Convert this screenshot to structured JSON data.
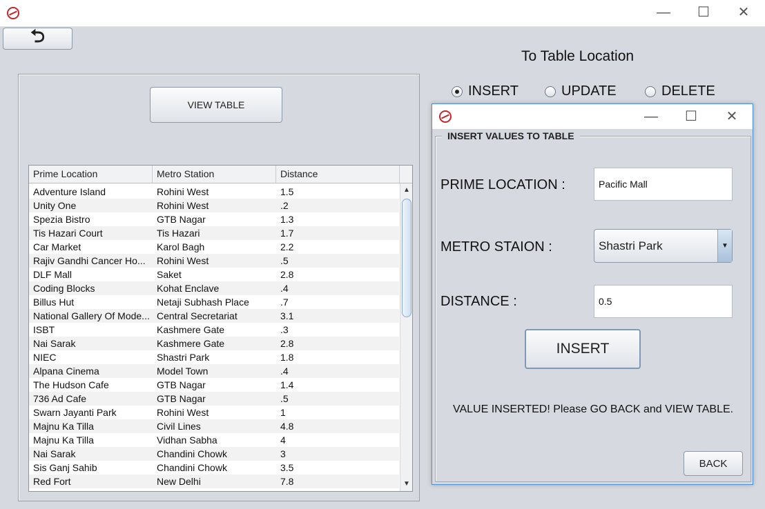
{
  "window": {
    "minimize": "—",
    "maximize": "☐",
    "close": "✕"
  },
  "toolbar": {
    "back_symbol": "⮌"
  },
  "header": {
    "title": "To Table Location"
  },
  "left": {
    "view_button": "VIEW TABLE",
    "table": {
      "columns": [
        "Prime Location",
        "Metro Station",
        "Distance"
      ],
      "rows": [
        [
          "Adventure Island",
          "Rohini West",
          "1.5"
        ],
        [
          "Unity One",
          "Rohini West",
          ".2"
        ],
        [
          "Spezia Bistro",
          "GTB Nagar",
          "1.3"
        ],
        [
          "Tis Hazari Court",
          "Tis Hazari",
          "1.7"
        ],
        [
          "Car Market",
          "Karol Bagh",
          "2.2"
        ],
        [
          "Rajiv Gandhi Cancer Ho...",
          "Rohini West",
          ".5"
        ],
        [
          "DLF Mall",
          "Saket",
          "2.8"
        ],
        [
          "Coding Blocks",
          "Kohat Enclave",
          ".4"
        ],
        [
          "Billus Hut",
          "Netaji Subhash Place",
          ".7"
        ],
        [
          "National Gallery Of Mode...",
          "Central Secretariat",
          "3.1"
        ],
        [
          "ISBT",
          "Kashmere Gate",
          ".3"
        ],
        [
          "Nai Sarak",
          "Kashmere Gate",
          "2.8"
        ],
        [
          "NIEC",
          "Shastri Park",
          "1.8"
        ],
        [
          "Alpana Cinema",
          "Model Town",
          ".4"
        ],
        [
          "The Hudson Cafe",
          "GTB Nagar",
          "1.4"
        ],
        [
          "736 Ad Cafe",
          "GTB Nagar",
          ".5"
        ],
        [
          "Swarn Jayanti Park",
          "Rohini West",
          "1"
        ],
        [
          "Majnu Ka Tilla",
          "Civil Lines",
          "4.8"
        ],
        [
          "Majnu Ka Tilla",
          "Vidhan Sabha",
          "4"
        ],
        [
          "Nai Sarak",
          "Chandini Chowk",
          "3"
        ],
        [
          "Sis Ganj Sahib",
          "Chandini Chowk",
          "3.5"
        ],
        [
          "Red Fort",
          "New Delhi",
          "7.8"
        ]
      ]
    }
  },
  "modes": {
    "insert": "INSERT",
    "update": "UPDATE",
    "delete": "DELETE",
    "selected": "INSERT"
  },
  "dialog": {
    "group_title": "INSERT VALUES TO TABLE",
    "prime_label": "PRIME LOCATION :",
    "prime_value": "Pacific Mall",
    "metro_label": "METRO STAION :",
    "metro_value": "Shastri Park",
    "distance_label": "DISTANCE :",
    "distance_value": "0.5",
    "insert_button": "INSERT",
    "status": "VALUE INSERTED! Please GO BACK and VIEW TABLE.",
    "back_button": "BACK"
  },
  "colors": {
    "logo": "#c0292b",
    "dialog_border": "#4a90d9"
  }
}
